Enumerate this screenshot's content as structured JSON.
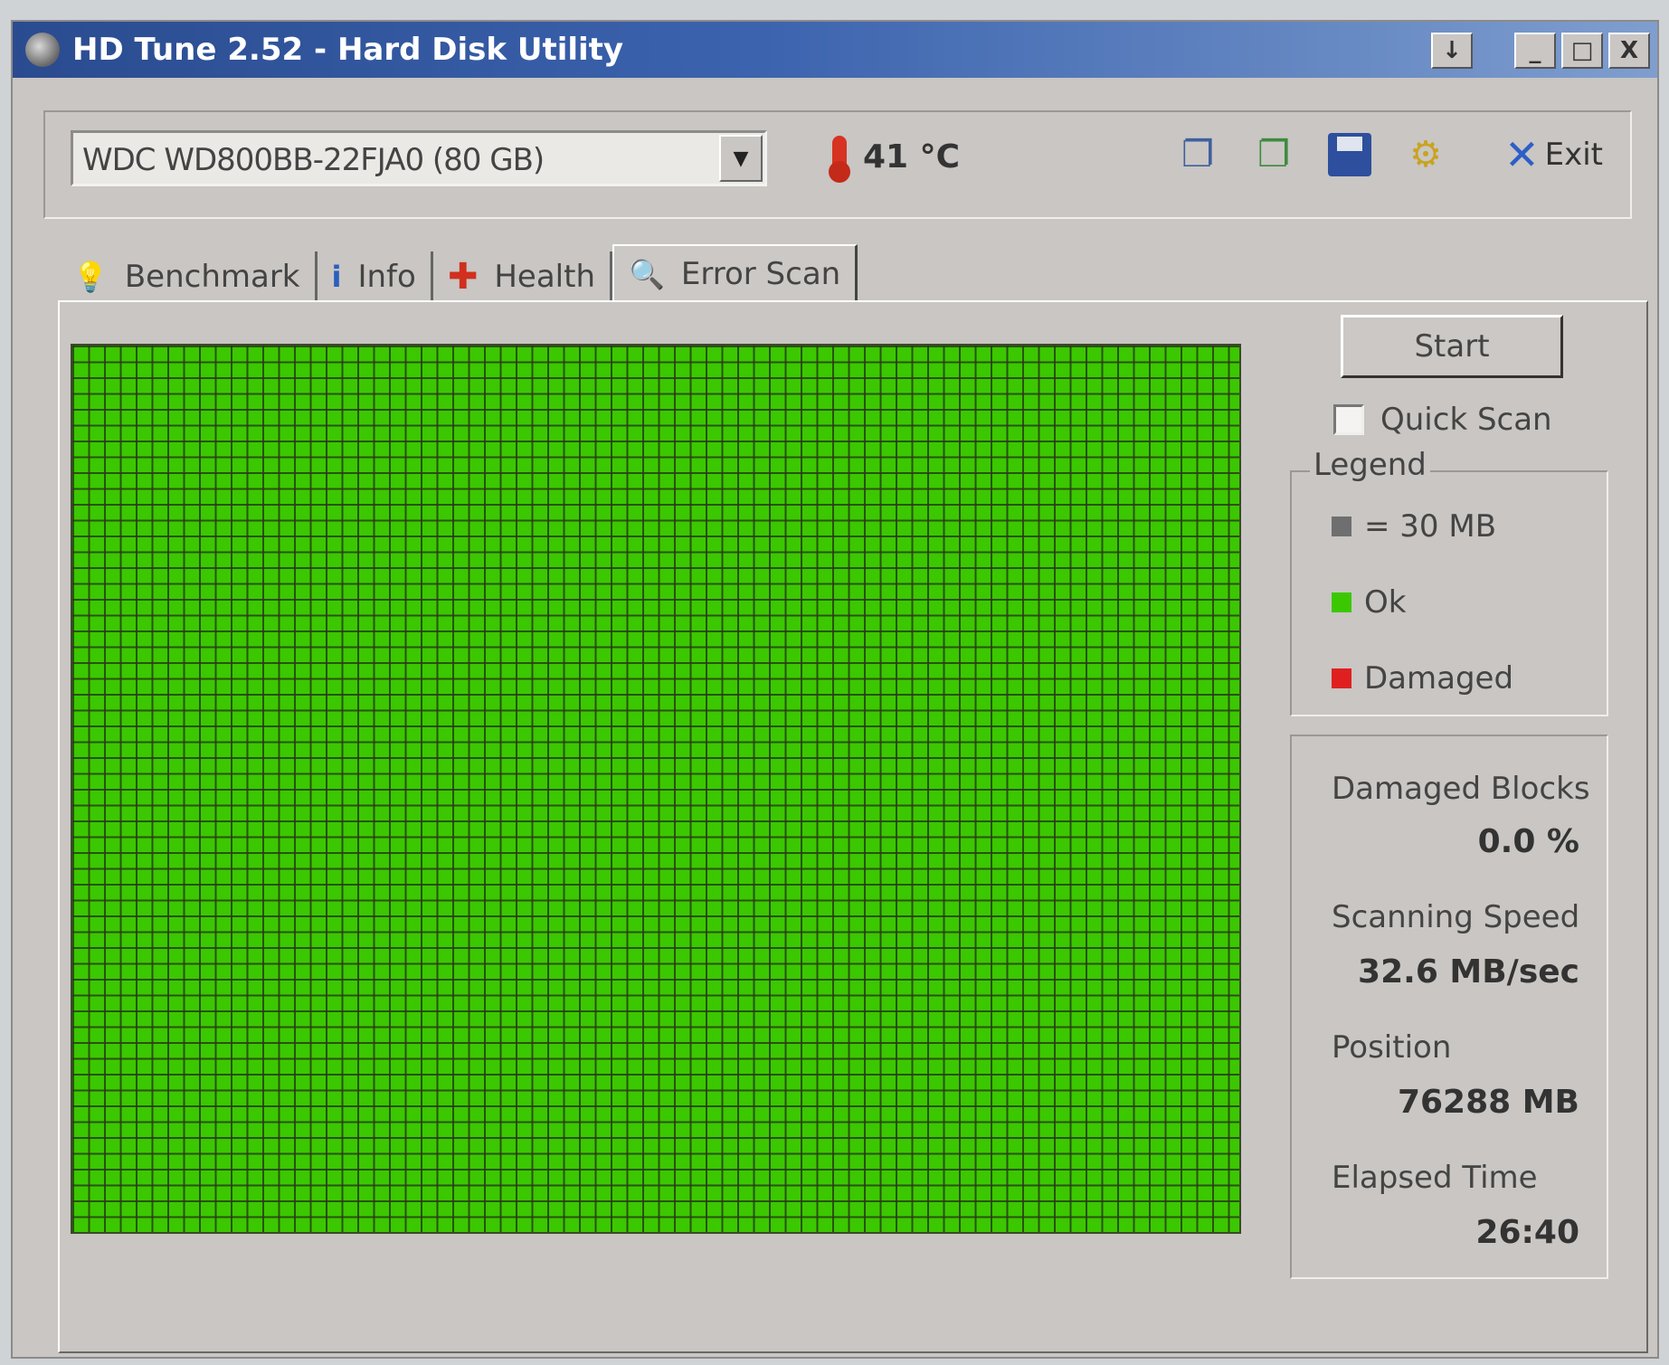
{
  "window": {
    "title": "HD Tune 2.52 - Hard Disk Utility",
    "buttons": {
      "download": "↓",
      "minimize": "_",
      "maximize": "□",
      "close": "X"
    }
  },
  "toolbar": {
    "drive": "WDC WD800BB-22FJA0 (80 GB)",
    "temperature": "41 °C",
    "exit_label": "Exit"
  },
  "tabs": [
    "Benchmark",
    "Info",
    "Health",
    "Error Scan"
  ],
  "scan": {
    "start_label": "Start",
    "quick_scan_label": "Quick Scan",
    "quick_scan_checked": false
  },
  "legend": {
    "title": "Legend",
    "block_size": "= 30 MB",
    "ok": "Ok",
    "damaged": "Damaged",
    "colors": {
      "block": "#6f6f6f",
      "ok": "#3bc800",
      "damaged": "#e02020"
    }
  },
  "stats": {
    "damaged_blocks_label": "Damaged Blocks",
    "damaged_blocks_value": "0.0 %",
    "scanning_speed_label": "Scanning Speed",
    "scanning_speed_value": "32.6 MB/sec",
    "position_label": "Position",
    "position_value": "76288 MB",
    "elapsed_label": "Elapsed Time",
    "elapsed_value": "26:40"
  }
}
